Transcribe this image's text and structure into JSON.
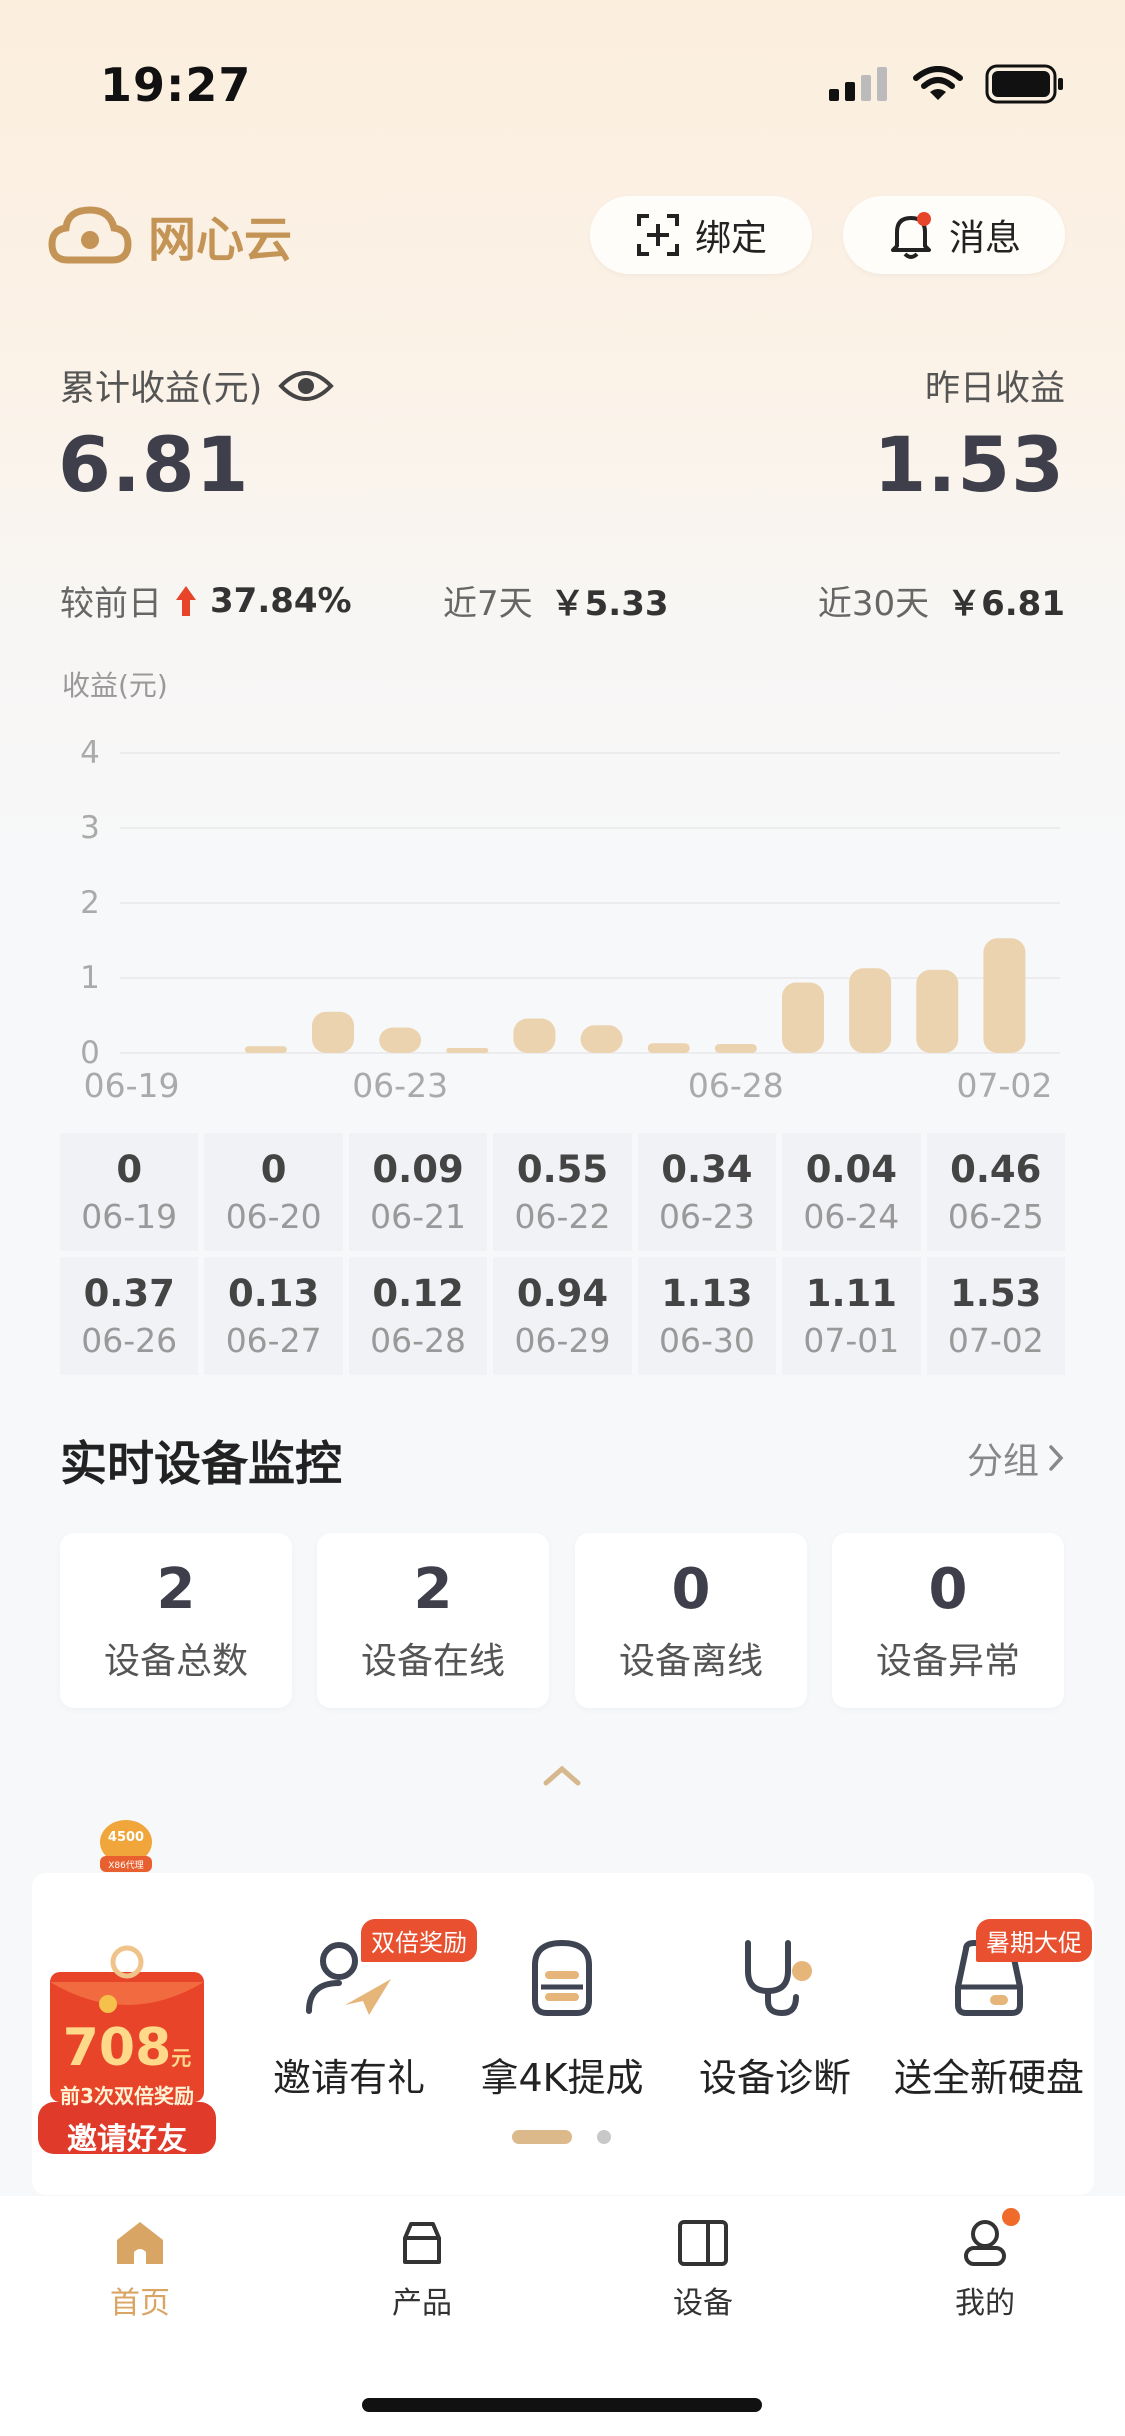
{
  "status_bar": {
    "time": "19:27"
  },
  "header": {
    "app_name": "网心云",
    "bind_label": "绑定",
    "message_label": "消息"
  },
  "earnings": {
    "total_label": "累计收益(元)",
    "total_value": "6.81",
    "yesterday_label": "昨日收益",
    "yesterday_value": "1.53",
    "compare_label": "较前日",
    "compare_value": "37.84%",
    "week_label": "近7天",
    "week_value": "￥5.33",
    "month_label": "近30天",
    "month_value": "￥6.81"
  },
  "chart_data": {
    "type": "bar",
    "ylabel": "收益(元)",
    "ylim": [
      0,
      4
    ],
    "yticks": [
      "0",
      "1",
      "2",
      "3",
      "4"
    ],
    "x_tick_labels": [
      "06-19",
      "06-23",
      "06-28",
      "07-02"
    ],
    "categories": [
      "06-19",
      "06-20",
      "06-21",
      "06-22",
      "06-23",
      "06-24",
      "06-25",
      "06-26",
      "06-27",
      "06-28",
      "06-29",
      "06-30",
      "07-01",
      "07-02"
    ],
    "values": [
      0,
      0,
      0.09,
      0.55,
      0.34,
      0.04,
      0.46,
      0.37,
      0.13,
      0.12,
      0.94,
      1.13,
      1.11,
      1.53
    ],
    "bar_color": "#ecd3b0",
    "grid": true
  },
  "daily_table": [
    {
      "value": "0",
      "date": "06-19"
    },
    {
      "value": "0",
      "date": "06-20"
    },
    {
      "value": "0.09",
      "date": "06-21"
    },
    {
      "value": "0.55",
      "date": "06-22"
    },
    {
      "value": "0.34",
      "date": "06-23"
    },
    {
      "value": "0.04",
      "date": "06-24"
    },
    {
      "value": "0.46",
      "date": "06-25"
    },
    {
      "value": "0.37",
      "date": "06-26"
    },
    {
      "value": "0.13",
      "date": "06-27"
    },
    {
      "value": "0.12",
      "date": "06-28"
    },
    {
      "value": "0.94",
      "date": "06-29"
    },
    {
      "value": "1.13",
      "date": "06-30"
    },
    {
      "value": "1.11",
      "date": "07-01"
    },
    {
      "value": "1.53",
      "date": "07-02"
    }
  ],
  "monitor": {
    "title": "实时设备监控",
    "group_label": "分组",
    "stats": [
      {
        "value": "2",
        "label": "设备总数"
      },
      {
        "value": "2",
        "label": "设备在线"
      },
      {
        "value": "0",
        "label": "设备离线"
      },
      {
        "value": "0",
        "label": "设备异常"
      }
    ]
  },
  "promo": {
    "small_badge": "4500",
    "small_badge_sub": "X86代理",
    "envelope_amount": "708",
    "envelope_unit": "元",
    "envelope_sub": "前3次双倍奖励",
    "envelope_button": "邀请好友",
    "features": [
      {
        "label": "邀请有礼",
        "tag": "双倍奖励",
        "icon": "invite-icon"
      },
      {
        "label": "拿4K提成",
        "tag": "",
        "icon": "server-icon"
      },
      {
        "label": "设备诊断",
        "tag": "",
        "icon": "stethoscope-icon"
      },
      {
        "label": "送全新硬盘",
        "tag": "暑期大促",
        "icon": "hard-drive-icon"
      }
    ]
  },
  "tabs": [
    {
      "label": "首页",
      "active": true
    },
    {
      "label": "产品",
      "active": false
    },
    {
      "label": "设备",
      "active": false
    },
    {
      "label": "我的",
      "active": false
    }
  ],
  "colors": {
    "accent": "#c49456",
    "active_tab": "#d9a564",
    "inactive_tab": "#333333",
    "up_arrow": "#e8442a"
  }
}
